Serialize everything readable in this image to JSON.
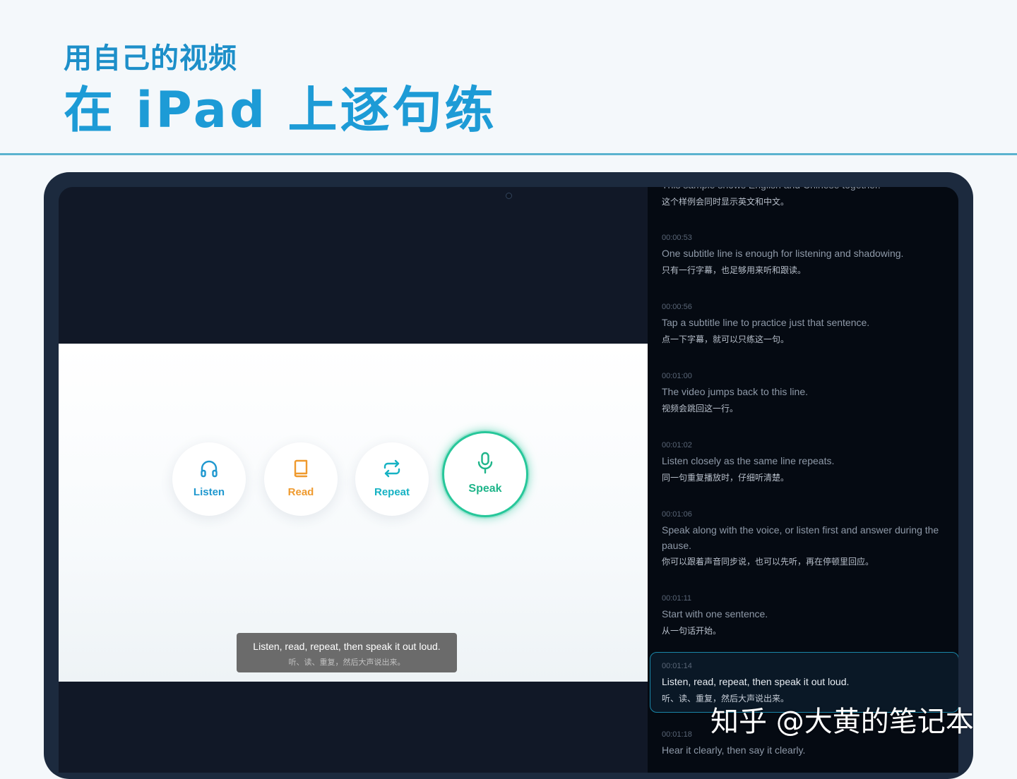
{
  "header": {
    "subtitle": "用自己的视频",
    "title": "在 iPad 上逐句练"
  },
  "video": {
    "buttons": [
      {
        "label": "Listen",
        "icon": "headphones-icon",
        "color": "#1f98cf"
      },
      {
        "label": "Read",
        "icon": "book-icon",
        "color": "#ef9a2e"
      },
      {
        "label": "Repeat",
        "icon": "repeat-icon",
        "color": "#16b2c3"
      },
      {
        "label": "Speak",
        "icon": "microphone-icon",
        "color": "#1fb58a",
        "active": true
      }
    ],
    "caption": {
      "en": "Listen, read, repeat, then speak it out loud.",
      "zh": "听、读、重复，然后大声说出来。"
    }
  },
  "subtitles": [
    {
      "time": "",
      "en": "This sample shows English and Chinese together.",
      "zh": "这个样例会同时显示英文和中文。"
    },
    {
      "time": "00:00:53",
      "en": "One subtitle line is enough for listening and shadowing.",
      "zh": "只有一行字幕，也足够用来听和跟读。"
    },
    {
      "time": "00:00:56",
      "en": "Tap a subtitle line to practice just that sentence.",
      "zh": "点一下字幕，就可以只练这一句。"
    },
    {
      "time": "00:01:00",
      "en": "The video jumps back to this line.",
      "zh": "视频会跳回这一行。"
    },
    {
      "time": "00:01:02",
      "en": "Listen closely as the same line repeats.",
      "zh": "同一句重复播放时，仔细听清楚。"
    },
    {
      "time": "00:01:06",
      "en": "Speak along with the voice, or listen first and answer during the pause.",
      "zh": "你可以跟着声音同步说，也可以先听，再在停顿里回应。"
    },
    {
      "time": "00:01:11",
      "en": "Start with one sentence.",
      "zh": "从一句话开始。"
    },
    {
      "time": "00:01:14",
      "en": "Listen, read, repeat, then speak it out loud.",
      "zh": "听、读、重复，然后大声说出来。",
      "active": true
    },
    {
      "time": "00:01:18",
      "en": "Hear it clearly, then say it clearly.",
      "zh": ""
    }
  ],
  "watermark": "知乎 @大黄的笔记本"
}
